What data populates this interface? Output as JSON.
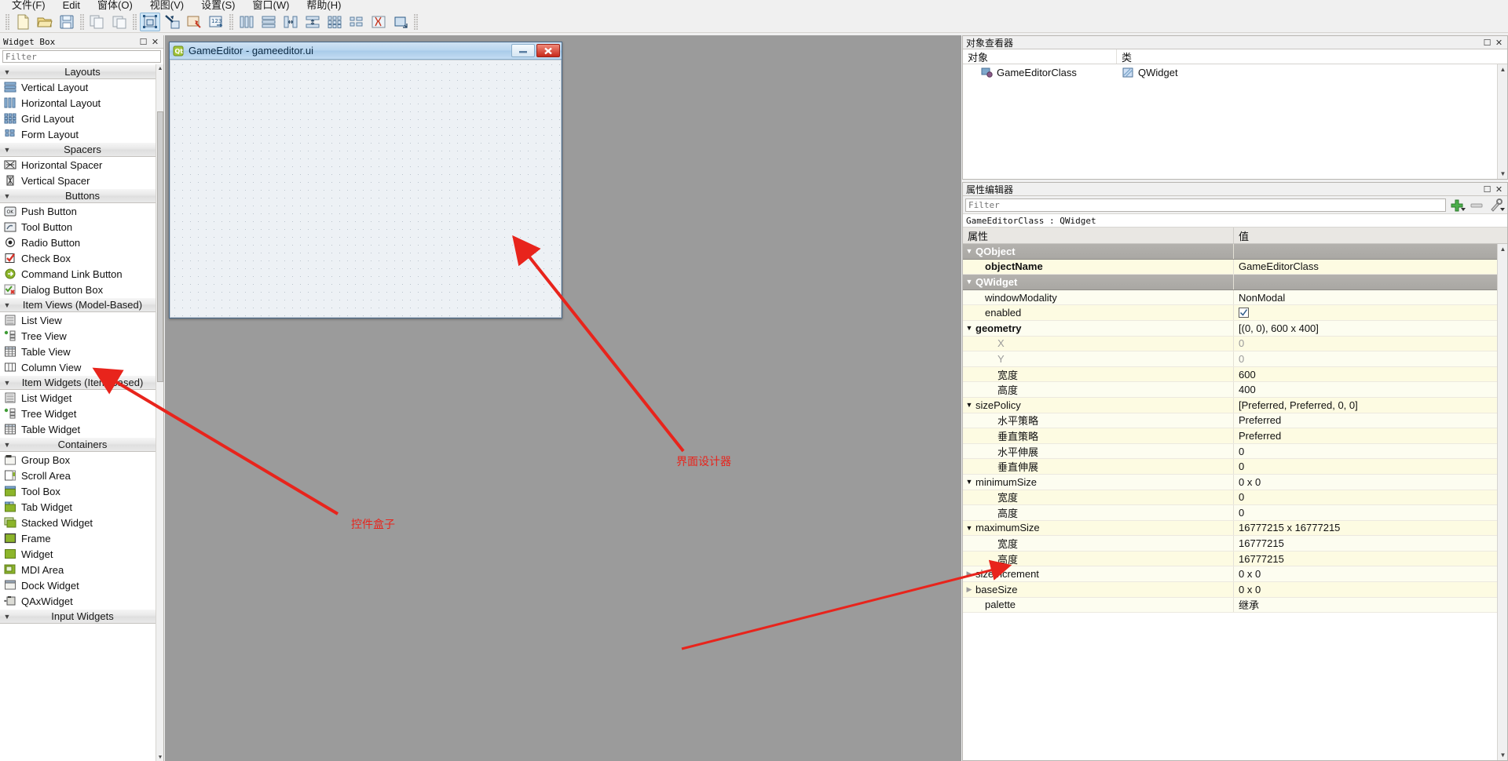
{
  "menubar": {
    "items": [
      {
        "label": "文件(F)",
        "name": "menu-file"
      },
      {
        "label": "Edit",
        "name": "menu-edit"
      },
      {
        "label": "窗体(O)",
        "name": "menu-form"
      },
      {
        "label": "视图(V)",
        "name": "menu-view"
      },
      {
        "label": "设置(S)",
        "name": "menu-settings"
      },
      {
        "label": "窗口(W)",
        "name": "menu-window"
      },
      {
        "label": "帮助(H)",
        "name": "menu-help"
      }
    ]
  },
  "toolbar": {
    "groups": [
      [
        "new-file",
        "open-folder",
        "save-file"
      ],
      [
        "copy",
        "paste"
      ],
      [
        "edit-widgets",
        "edit-signals-slots",
        "edit-buddies",
        "edit-tab-order"
      ],
      [
        "layout-horizontal",
        "layout-vertical",
        "layout-splitter-h",
        "layout-splitter-v",
        "layout-grid",
        "layout-form",
        "break-layout",
        "adjust-size"
      ]
    ]
  },
  "widgetbox": {
    "title": "Widget Box",
    "filter_placeholder": "Filter",
    "filter_value": "",
    "categories": [
      {
        "label": "Layouts",
        "expanded": true,
        "items": [
          {
            "label": "Vertical Layout",
            "icon": "vertical-layout-icon"
          },
          {
            "label": "Horizontal Layout",
            "icon": "horizontal-layout-icon"
          },
          {
            "label": "Grid Layout",
            "icon": "grid-layout-icon"
          },
          {
            "label": "Form Layout",
            "icon": "form-layout-icon"
          }
        ]
      },
      {
        "label": "Spacers",
        "expanded": true,
        "items": [
          {
            "label": "Horizontal Spacer",
            "icon": "horizontal-spacer-icon"
          },
          {
            "label": "Vertical Spacer",
            "icon": "vertical-spacer-icon"
          }
        ]
      },
      {
        "label": "Buttons",
        "expanded": true,
        "items": [
          {
            "label": "Push Button",
            "icon": "push-button-icon"
          },
          {
            "label": "Tool Button",
            "icon": "tool-button-icon"
          },
          {
            "label": "Radio Button",
            "icon": "radio-button-icon"
          },
          {
            "label": "Check Box",
            "icon": "check-box-icon"
          },
          {
            "label": "Command Link Button",
            "icon": "command-link-button-icon"
          },
          {
            "label": "Dialog Button Box",
            "icon": "dialog-button-box-icon"
          }
        ]
      },
      {
        "label": "Item Views (Model-Based)",
        "expanded": true,
        "items": [
          {
            "label": "List View",
            "icon": "list-view-icon"
          },
          {
            "label": "Tree View",
            "icon": "tree-view-icon"
          },
          {
            "label": "Table View",
            "icon": "table-view-icon"
          },
          {
            "label": "Column View",
            "icon": "column-view-icon"
          }
        ]
      },
      {
        "label": "Item Widgets (Item-Based)",
        "expanded": true,
        "items": [
          {
            "label": "List Widget",
            "icon": "list-widget-icon"
          },
          {
            "label": "Tree Widget",
            "icon": "tree-widget-icon"
          },
          {
            "label": "Table Widget",
            "icon": "table-widget-icon"
          }
        ]
      },
      {
        "label": "Containers",
        "expanded": true,
        "items": [
          {
            "label": "Group Box",
            "icon": "group-box-icon"
          },
          {
            "label": "Scroll Area",
            "icon": "scroll-area-icon"
          },
          {
            "label": "Tool Box",
            "icon": "tool-box-icon"
          },
          {
            "label": "Tab Widget",
            "icon": "tab-widget-icon"
          },
          {
            "label": "Stacked Widget",
            "icon": "stacked-widget-icon"
          },
          {
            "label": "Frame",
            "icon": "frame-icon"
          },
          {
            "label": "Widget",
            "icon": "widget-icon"
          },
          {
            "label": "MDI Area",
            "icon": "mdi-area-icon"
          },
          {
            "label": "Dock Widget",
            "icon": "dock-widget-icon"
          },
          {
            "label": "QAxWidget",
            "icon": "qax-widget-icon"
          }
        ]
      },
      {
        "label": "Input Widgets",
        "expanded": true,
        "items": []
      }
    ]
  },
  "form_window": {
    "title": "GameEditor - gameeditor.ui",
    "minimize_label": "",
    "close_label": "✕"
  },
  "object_inspector": {
    "title": "对象查看器",
    "columns": [
      "对象",
      "类"
    ],
    "rows": [
      {
        "object": "GameEditorClass",
        "class": "QWidget"
      }
    ]
  },
  "property_editor": {
    "title": "属性编辑器",
    "filter_placeholder": "Filter",
    "filter_value": "",
    "class_line": "GameEditorClass : QWidget",
    "columns": [
      "属性",
      "值"
    ],
    "buttons": [
      "add-property-button",
      "remove-property-button",
      "configure-button"
    ],
    "rows": [
      {
        "name": "QObject",
        "value": "",
        "kind": "group",
        "chevron": "v",
        "indent": 0
      },
      {
        "name": "objectName",
        "value": "GameEditorClass",
        "kind": "yellow",
        "bold": true,
        "indent": 1
      },
      {
        "name": "QWidget",
        "value": "",
        "kind": "group",
        "chevron": "v",
        "indent": 0
      },
      {
        "name": "windowModality",
        "value": "NonModal",
        "kind": "yellow2",
        "indent": 1
      },
      {
        "name": "enabled",
        "value": "☑",
        "kind": "yellow",
        "indent": 1,
        "checkbox": true
      },
      {
        "name": "geometry",
        "value": "[(0, 0), 600 x 400]",
        "kind": "yellow2",
        "chevron": "v",
        "bold": true,
        "indent": 0
      },
      {
        "name": "X",
        "value": "0",
        "kind": "yellow",
        "indent": 2,
        "dim": true
      },
      {
        "name": "Y",
        "value": "0",
        "kind": "yellow2",
        "indent": 2,
        "dim": true
      },
      {
        "name": "宽度",
        "value": "600",
        "kind": "yellow",
        "indent": 2
      },
      {
        "name": "高度",
        "value": "400",
        "kind": "yellow2",
        "indent": 2
      },
      {
        "name": "sizePolicy",
        "value": "[Preferred, Preferred, 0, 0]",
        "kind": "yellow",
        "chevron": "v",
        "indent": 0
      },
      {
        "name": "水平策略",
        "value": "Preferred",
        "kind": "yellow2",
        "indent": 2
      },
      {
        "name": "垂直策略",
        "value": "Preferred",
        "kind": "yellow",
        "indent": 2
      },
      {
        "name": "水平伸展",
        "value": "0",
        "kind": "yellow2",
        "indent": 2
      },
      {
        "name": "垂直伸展",
        "value": "0",
        "kind": "yellow",
        "indent": 2
      },
      {
        "name": "minimumSize",
        "value": "0 x 0",
        "kind": "yellow2",
        "chevron": "v",
        "indent": 0
      },
      {
        "name": "宽度",
        "value": "0",
        "kind": "yellow",
        "indent": 2
      },
      {
        "name": "高度",
        "value": "0",
        "kind": "yellow2",
        "indent": 2
      },
      {
        "name": "maximumSize",
        "value": "16777215 x 16777215",
        "kind": "yellow",
        "chevron": "v",
        "indent": 0
      },
      {
        "name": "宽度",
        "value": "16777215",
        "kind": "yellow2",
        "indent": 2
      },
      {
        "name": "高度",
        "value": "16777215",
        "kind": "yellow",
        "indent": 2
      },
      {
        "name": "sizeIncrement",
        "value": "0 x 0",
        "kind": "yellow2",
        "chevron": ">",
        "indent": 0
      },
      {
        "name": "baseSize",
        "value": "0 x 0",
        "kind": "yellow",
        "chevron": ">",
        "indent": 0
      },
      {
        "name": "palette",
        "value": "继承",
        "kind": "yellow2",
        "indent": 1
      }
    ]
  },
  "annotations": [
    {
      "text": "界面设计器",
      "name": "annotation-ui-designer"
    },
    {
      "text": "控件盒子",
      "name": "annotation-widget-box"
    }
  ],
  "colors": {
    "annotation_red": "#e8241c",
    "canvas_gray": "#9b9b9b",
    "property_yellow": "#fdfbe2",
    "group_gray": "#b4b2ae"
  }
}
